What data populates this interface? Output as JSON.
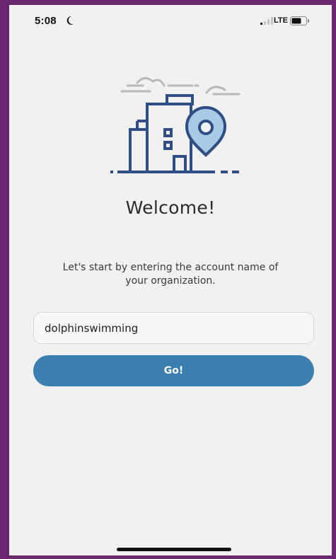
{
  "status_bar": {
    "time": "5:08",
    "network": "LTE",
    "icons": [
      "moon-icon",
      "signal-icon",
      "battery-icon"
    ]
  },
  "illustration": {
    "icon": "city-location-pin-icon",
    "color": "#2f4e86",
    "cloud_color": "#b9b9b9"
  },
  "welcome": {
    "title": "Welcome!",
    "instructions": "Let's start by entering the account name of your organization."
  },
  "account_field": {
    "value": "dolphinswimming"
  },
  "go_button": {
    "label": "Go!",
    "color": "#3a7fb0"
  }
}
